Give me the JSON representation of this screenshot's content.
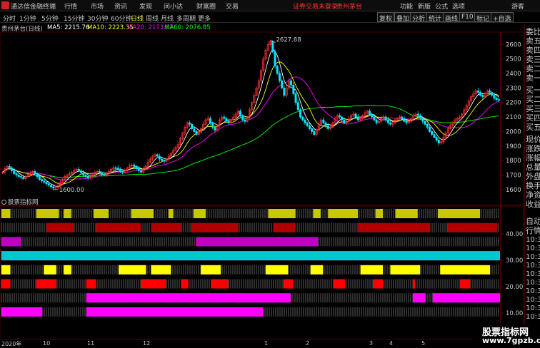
{
  "menubar": {
    "app_title": "通达信金融终端",
    "menus": [
      "行情",
      "市场",
      "资讯",
      "发现",
      "问小达",
      "财富圈",
      "交易"
    ],
    "warning": "证券交易未登录",
    "stock": "贵州茅台",
    "right_menus": [
      "功能",
      "新版",
      "公式",
      "选项"
    ],
    "guest": "游客"
  },
  "periods": [
    "分时",
    "1分钟",
    "5分钟",
    "15分钟",
    "30分钟",
    "60分钟",
    "日线",
    "周线",
    "月线",
    "多周期",
    "更多"
  ],
  "active_period": "日线",
  "tools": [
    "复权",
    "叠加",
    "分析",
    "统计",
    "画线",
    "F10",
    "标记",
    "+自选"
  ],
  "chart_info": {
    "title": "贵州茅台(日线)",
    "ma5": "MA5: 2215.76",
    "ma10": "MA10: 2223.35",
    "ma20": "MA20: 2173.07",
    "ma60": "MA60: 2076.85",
    "high_label": "2627.88",
    "low_label": "1600.00"
  },
  "indicator_panel_label": "股票指标网",
  "right_panel": {
    "labels": [
      "委比",
      "卖五",
      "卖四",
      "卖三",
      "卖二",
      "卖一",
      "买一",
      "买二",
      "买三",
      "买四",
      "买五",
      "现价",
      "涨跌",
      "涨幅",
      "总量",
      "外盘",
      "换手",
      "净资",
      "收益"
    ],
    "lower_labels": [
      "自动",
      "行情"
    ],
    "times": [
      "10:31",
      "10:31",
      "10:31",
      "10:31",
      "10:31",
      "10:31",
      "10:31",
      "10:32",
      "10:32",
      "10:32"
    ]
  },
  "colors": {
    "up": "#ff3030",
    "down": "#00e5ff",
    "ma5": "#ffffff",
    "ma10": "#ffff00",
    "ma20": "#ff00ff",
    "ma60": "#00ff00"
  },
  "x_labels": [
    "2020年",
    "10",
    "11",
    "12",
    "1",
    "2",
    "3",
    "4",
    "5"
  ],
  "watermark": {
    "line1": "股票指标网",
    "line2": "www.7gpzb.com"
  },
  "chart_data": {
    "type": "candlestick",
    "title": "贵州茅台(日线)",
    "y_ticks": [
      2600,
      2500,
      2400,
      2300,
      2200,
      2100,
      2000,
      1900,
      1800,
      1700,
      1600
    ],
    "ylim": [
      1560,
      2680
    ],
    "x_ticks": [
      "2020年",
      "10",
      "11",
      "12",
      "1",
      "2",
      "3",
      "4",
      "5"
    ],
    "indicator_ticks": [
      40,
      30,
      20,
      10
    ],
    "indicator_ylim": [
      0,
      47
    ],
    "closes": [
      1720,
      1745,
      1760,
      1750,
      1730,
      1710,
      1700,
      1690,
      1685,
      1675,
      1690,
      1705,
      1715,
      1725,
      1710,
      1690,
      1670,
      1660,
      1650,
      1640,
      1630,
      1620,
      1610,
      1615,
      1630,
      1650,
      1670,
      1690,
      1700,
      1710,
      1720,
      1735,
      1740,
      1730,
      1715,
      1700,
      1690,
      1680,
      1695,
      1710,
      1720,
      1725,
      1718,
      1705,
      1700,
      1710,
      1725,
      1740,
      1750,
      1748,
      1740,
      1725,
      1720,
      1730,
      1750,
      1765,
      1770,
      1760,
      1745,
      1730,
      1720,
      1740,
      1760,
      1790,
      1810,
      1830,
      1840,
      1830,
      1810,
      1800,
      1795,
      1810,
      1830,
      1850,
      1870,
      1890,
      1910,
      1950,
      1990,
      2030,
      2060,
      2050,
      2020,
      2000,
      1980,
      1995,
      2020,
      2050,
      2080,
      2090,
      2060,
      2030,
      2010,
      2040,
      2080,
      2100,
      2090,
      2070,
      2060,
      2080,
      2100,
      2120,
      2140,
      2110,
      2080,
      2070,
      2100,
      2150,
      2200,
      2250,
      2300,
      2350,
      2420,
      2500,
      2560,
      2600,
      2620,
      2550,
      2450,
      2400,
      2350,
      2300,
      2250,
      2300,
      2350,
      2320,
      2260,
      2200,
      2150,
      2100,
      2080,
      2060,
      2040,
      2020,
      2000,
      1980,
      2010,
      2050,
      2080,
      2060,
      2040,
      2020,
      2030,
      2060,
      2090,
      2110,
      2100,
      2080,
      2060,
      2070,
      2090,
      2110,
      2120,
      2100,
      2080,
      2090,
      2110,
      2130,
      2140,
      2120,
      2100,
      2080,
      2060,
      2070,
      2090,
      2100,
      2080,
      2060,
      2050,
      2060,
      2080,
      2090,
      2100,
      2090,
      2070,
      2060,
      2070,
      2090,
      2110,
      2120,
      2110,
      2090,
      2070,
      2050,
      2030,
      2000,
      1980,
      1960,
      1940,
      1920,
      1930,
      1960,
      1990,
      2020,
      2040,
      2060,
      2080,
      2090,
      2100,
      2120,
      2150,
      2180,
      2210,
      2240,
      2260,
      2280,
      2270,
      2250,
      2240,
      2260,
      2280,
      2270,
      2250,
      2230,
      2220,
      2215
    ],
    "bands": [
      {
        "row": 0,
        "color": "#c8c800",
        "segments": [
          [
            0.0,
            0.018
          ],
          [
            0.07,
            0.115
          ],
          [
            0.125,
            0.14
          ],
          [
            0.185,
            0.215
          ],
          [
            0.26,
            0.305
          ],
          [
            0.335,
            0.345
          ],
          [
            0.385,
            0.41
          ],
          [
            0.535,
            0.59
          ],
          [
            0.625,
            0.64
          ],
          [
            0.655,
            0.715
          ],
          [
            0.75,
            0.765
          ],
          [
            0.79,
            0.835
          ],
          [
            0.875,
            0.96
          ]
        ]
      },
      {
        "row": 1,
        "color": "#b00000",
        "segments": [
          [
            0.09,
            0.145
          ],
          [
            0.19,
            0.28
          ],
          [
            0.3,
            0.36
          ],
          [
            0.38,
            0.475
          ],
          [
            0.545,
            0.59
          ],
          [
            0.715,
            0.86
          ],
          [
            0.895,
            0.995
          ]
        ]
      },
      {
        "row": 2,
        "color": "#c000c0",
        "segments": [
          [
            0.0,
            0.04
          ],
          [
            0.39,
            0.635
          ]
        ]
      },
      {
        "row": 3,
        "color": "#00c8d0",
        "segments": [
          [
            0.0,
            1.0
          ]
        ]
      },
      {
        "row": 4,
        "color": "#ffff00",
        "segments": [
          [
            0.0,
            0.018
          ],
          [
            0.085,
            0.11
          ],
          [
            0.125,
            0.14
          ],
          [
            0.235,
            0.29
          ],
          [
            0.3,
            0.34
          ],
          [
            0.4,
            0.44
          ],
          [
            0.53,
            0.575
          ],
          [
            0.62,
            0.645
          ],
          [
            0.72,
            0.765
          ],
          [
            0.78,
            0.84
          ],
          [
            0.88,
            0.98
          ]
        ]
      },
      {
        "row": 5,
        "color": "#ff0000",
        "segments": [
          [
            0.0,
            0.018
          ],
          [
            0.07,
            0.11
          ],
          [
            0.17,
            0.19
          ],
          [
            0.28,
            0.33
          ],
          [
            0.36,
            0.375
          ],
          [
            0.42,
            0.455
          ],
          [
            0.565,
            0.585
          ],
          [
            0.665,
            0.69
          ],
          [
            0.745,
            0.765
          ],
          [
            0.825,
            0.83
          ],
          [
            0.92,
            0.94
          ]
        ]
      },
      {
        "row": 6,
        "color": "#ff00ff",
        "segments": [
          [
            0.17,
            0.58
          ],
          [
            0.825,
            0.85
          ],
          [
            0.865,
            1.0
          ]
        ]
      },
      {
        "row": 7,
        "color": "#ff00ff",
        "segments": [
          [
            0.0,
            0.082
          ],
          [
            0.17,
            0.525
          ]
        ]
      }
    ]
  }
}
